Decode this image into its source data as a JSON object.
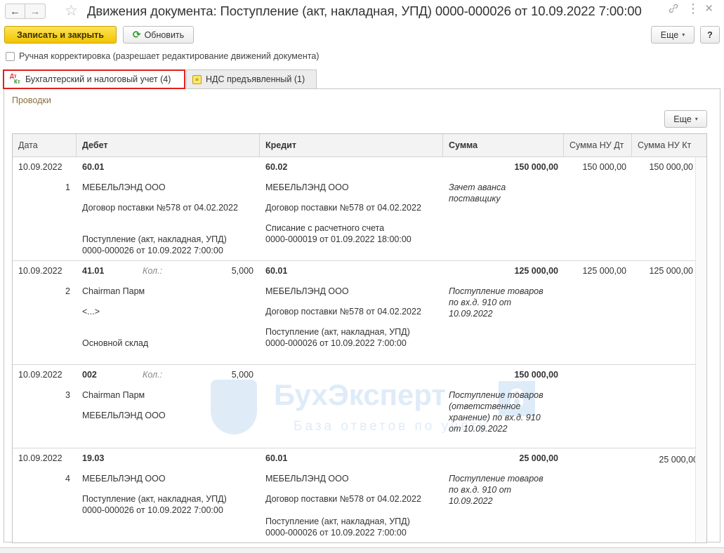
{
  "window": {
    "title": "Движения документа: Поступление (акт, накладная, УПД) 0000-000026 от 10.09.2022 7:00:00",
    "back_icon": "←",
    "forward_icon": "→",
    "star_icon": "☆",
    "link_icon": "🔗",
    "menu_icon": "⋮",
    "close_icon": "×"
  },
  "toolbar": {
    "save_close_label": "Записать и закрыть",
    "refresh_label": "Обновить",
    "refresh_icon": "⟳",
    "more_label": "Еще",
    "help_label": "?",
    "caret": "▾"
  },
  "manual_edit": {
    "label": "Ручная корректировка (разрешает редактирование движений документа)",
    "checked": false
  },
  "tabs": [
    {
      "label": "Бухгалтерский и налоговый учет (4)",
      "icon_dt": "Дт",
      "icon_kt": "Кт",
      "active": true
    },
    {
      "label": "НДС предъявленный (1)",
      "icon": "≡",
      "active": false
    }
  ],
  "section": {
    "label": "Проводки",
    "more_label": "Еще"
  },
  "columns": [
    "Дата",
    "Дебет",
    "Кредит",
    "Сумма",
    "Сумма НУ Дт",
    "Сумма НУ Кт"
  ],
  "rows": [
    {
      "date": "10.09.2022",
      "num": "1",
      "debit_account": "60.01",
      "debit_qty_label": "",
      "debit_qty": "",
      "debit_lines": [
        "МЕБЕЛЬЛЭНД ООО",
        "Договор поставки №578 от 04.02.2022",
        "",
        "Поступление (акт, накладная, УПД)",
        "0000-000026 от 10.09.2022 7:00:00"
      ],
      "credit_account": "60.02",
      "credit_lines": [
        "МЕБЕЛЬЛЭНД ООО",
        "Договор поставки №578 от 04.02.2022",
        "Списание с расчетного счета",
        "0000-000019 от 01.09.2022 18:00:00"
      ],
      "sum": "150 000,00",
      "content": [
        "Зачет аванса",
        "поставщику"
      ],
      "sum_nu_dt": "150 000,00",
      "sum_nu_kt": "150 000,00"
    },
    {
      "date": "10.09.2022",
      "num": "2",
      "debit_account": "41.01",
      "debit_qty_label": "Кол.:",
      "debit_qty": "5,000",
      "debit_lines": [
        "Chairman Парм",
        "<...>",
        "Основной склад"
      ],
      "credit_account": "60.01",
      "credit_lines": [
        "МЕБЕЛЬЛЭНД ООО",
        "Договор поставки №578 от 04.02.2022",
        "Поступление (акт, накладная, УПД)",
        "0000-000026 от 10.09.2022 7:00:00"
      ],
      "sum": "125 000,00",
      "content": [
        "Поступление товаров",
        "по вх.д. 910 от",
        "10.09.2022"
      ],
      "sum_nu_dt": "125 000,00",
      "sum_nu_kt": "125 000,00"
    },
    {
      "date": "10.09.2022",
      "num": "3",
      "debit_account": "002",
      "debit_qty_label": "Кол.:",
      "debit_qty": "5,000",
      "debit_lines": [
        "Chairman Парм",
        "МЕБЕЛЬЛЭНД ООО"
      ],
      "credit_account": "",
      "credit_lines": [],
      "sum": "150 000,00",
      "content": [
        "Поступление товаров",
        "(ответственное",
        "хранение) по вх.д. 910",
        "от 10.09.2022"
      ],
      "sum_nu_dt": "",
      "sum_nu_kt": ""
    },
    {
      "date": "10.09.2022",
      "num": "4",
      "debit_account": "19.03",
      "debit_qty_label": "",
      "debit_qty": "",
      "debit_lines": [
        "МЕБЕЛЬЛЭНД ООО",
        "Поступление (акт, накладная, УПД)",
        "0000-000026 от 10.09.2022 7:00:00"
      ],
      "credit_account": "60.01",
      "credit_lines": [
        "МЕБЕЛЬЛЭНД ООО",
        "Договор поставки №578 от 04.02.2022",
        "Поступление (акт, накладная, УПД)",
        "0000-000026 от 10.09.2022 7:00:00"
      ],
      "sum": "25 000,00",
      "content": [
        "Поступление товаров",
        "по вх.д. 910 от",
        "10.09.2022"
      ],
      "sum_nu_dt": "",
      "sum_nu_kt": "25 000,00"
    }
  ],
  "watermark": {
    "title": "БухЭксперт",
    "badge": "8",
    "subtitle": "База ответов по учету"
  }
}
